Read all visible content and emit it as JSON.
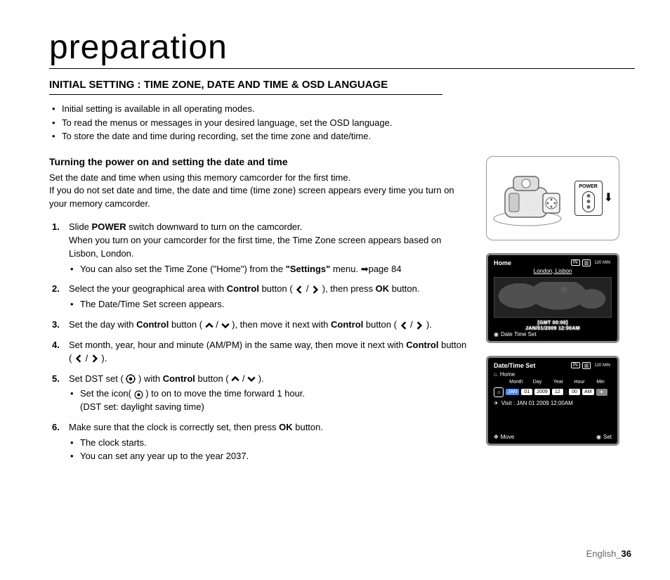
{
  "title": "preparation",
  "section_heading": "INITIAL SETTING : TIME ZONE, DATE AND TIME & OSD LANGUAGE",
  "intro_bullets": [
    "Initial setting is available in all operating modes.",
    "To read the menus or messages in your desired language, set the OSD language.",
    "To store the date and time during recording, set the time zone and date/time."
  ],
  "subheading": "Turning the power on and setting the date and time",
  "intro_para": "Set the date and time when using this memory camcorder for the first time.\nIf you do not set date and time, the date and time (time zone) screen appears every time you turn on your memory camcorder.",
  "steps": {
    "s1_a": "Slide ",
    "s1_power": "POWER",
    "s1_b": " switch downward to turn on the camcorder.",
    "s1_line2": "When you turn on your camcorder for the first time, the Time Zone screen appears based on Lisbon, London.",
    "s1_sub_a": "You can also set the Time Zone (\"Home\") from the ",
    "s1_settings": "\"Settings\"",
    "s1_sub_b": " menu. ➡page 84",
    "s2_a": "Select the your geographical area with ",
    "s2_ctrl": "Control",
    "s2_b": " button ( ",
    "s2_c": " ), then press ",
    "s2_ok": "OK",
    "s2_d": " button.",
    "s2_sub": "The Date/Time Set screen appears.",
    "s3_a": "Set the day with ",
    "s3_b": " button ( ",
    "s3_c": " ), then move it next with ",
    "s3_d": " button ( ",
    "s3_e": " ).",
    "s4_a": "Set month, year, hour and minute (AM/PM) in the same way, then move it next with ",
    "s4_b": " button ( ",
    "s4_c": " ).",
    "s5_a": "Set DST set ( ",
    "s5_b": " ) with ",
    "s5_c": " button ( ",
    "s5_d": " ).",
    "s5_sub1_a": "Set the icon( ",
    "s5_sub1_b": ") to on to move the time forward 1 hour.",
    "s5_sub2": "(DST set: daylight saving time)",
    "s6_a": "Make sure that the clock is correctly set, then press ",
    "s6_b": " button.",
    "s6_sub1": "The clock starts.",
    "s6_sub2": "You can set any year up to the year 2037."
  },
  "fig1": {
    "power_label": "POWER"
  },
  "fig2": {
    "title": "Home",
    "city": "London, Lisbon",
    "gmt": "[GMT 00:00]",
    "datetime": "JAN/01/2009 12:00AM",
    "footer": "Date Time Set",
    "badge1": "IN",
    "badge2": "120 MIN"
  },
  "fig3": {
    "title": "Date/Time Set",
    "home": "Home",
    "labels": {
      "month": "Month",
      "day": "Day",
      "year": "Year",
      "hour": "Hour",
      "min": "Min"
    },
    "values": {
      "month": "JAN",
      "day": "01",
      "year": "2009",
      "hour": "12",
      "min": "00",
      "ampm": "AM"
    },
    "visit": "Visit  :  JAN 01 2009 12:00AM",
    "move": "Move",
    "set": "Set",
    "badge1": "IN",
    "badge2": "120 MIN"
  },
  "footer": {
    "lang": "English_",
    "page": "36"
  }
}
